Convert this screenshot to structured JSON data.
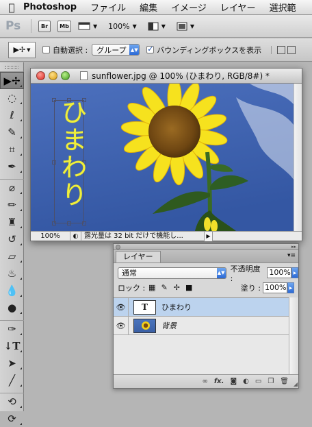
{
  "menubar": {
    "app_name": "Photoshop",
    "items": [
      "ファイル",
      "編集",
      "イメージ",
      "レイヤー",
      "選択範"
    ]
  },
  "appbar": {
    "logo": "Ps",
    "bridge_label": "Br",
    "minibridge_label": "Mb",
    "zoom": "100%"
  },
  "options": {
    "auto_select_label": "自動選択 :",
    "auto_select_checked": false,
    "auto_select_target": "グループ",
    "bounding_box_label": "バウンディングボックスを表示",
    "bounding_box_checked": true
  },
  "document": {
    "title": "sunflower.jpg @ 100% (ひまわり, RGB/8#) *",
    "canvas_text": "ひまわり",
    "zoom": "100%",
    "status_text": "露光量は 32 bit だけで機能し..."
  },
  "layers_panel": {
    "tab_label": "レイヤー",
    "blend_mode": "通常",
    "opacity_label": "不透明度 :",
    "opacity": "100%",
    "lock_label": "ロック :",
    "fill_label": "塗り :",
    "fill": "100%",
    "layers": [
      {
        "name": "ひまわり",
        "thumb": "T",
        "active": true
      },
      {
        "name": "背景",
        "locked": true,
        "active": false
      }
    ]
  },
  "colors": {
    "canvas_text": "#f0ef3c",
    "active_layer": "#bcd3ee",
    "sky": "#3f63b0"
  }
}
